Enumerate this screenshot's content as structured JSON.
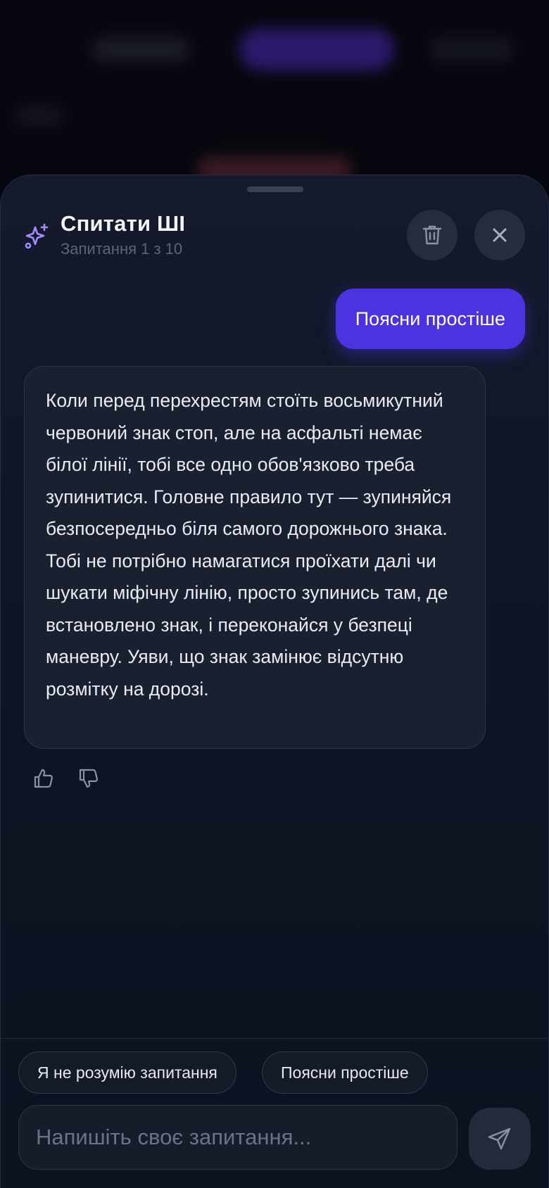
{
  "header": {
    "title": "Спитати ШІ",
    "subtitle": "Запитання 1 з 10",
    "icons": {
      "brand": "sparkle-icon",
      "delete": "trash-icon",
      "close": "close-icon"
    },
    "accent_color": "#a78bfa"
  },
  "chat": {
    "messages": [
      {
        "role": "user",
        "text": "Поясни простіше"
      },
      {
        "role": "assistant",
        "text": "Коли перед перехрестям стоїть восьмикутний червоний знак стоп, але на асфальті немає білої лінії, тобі все одно обов'язково треба зупинитися. Головне правило тут — зупиняйся безпосередньо біля самого дорожнього знака. Тобі не потрібно намагатися проїхати далі чи шукати міфічну лінію, просто зупинись там, де встановлено знак, і переконайся у безпеці маневру. Уяви, що знак замінює відсутню розмітку на дорозі."
      }
    ],
    "user_bubble_color": "#4b34e0",
    "feedback_icons": [
      "thumbs-up-icon",
      "thumbs-down-icon"
    ]
  },
  "suggestions": [
    "Я не розумію запитання",
    "Поясни простіше"
  ],
  "composer": {
    "placeholder": "Напишіть своє запитання...",
    "value": "",
    "send_icon": "send-icon"
  }
}
